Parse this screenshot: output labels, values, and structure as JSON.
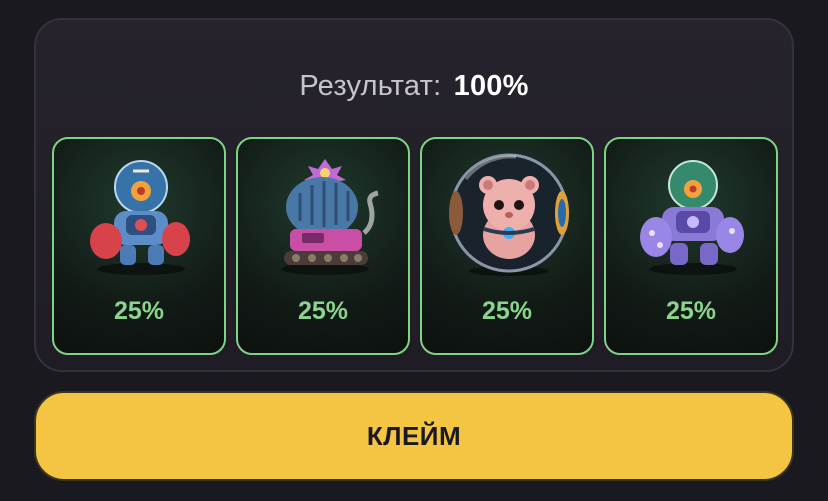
{
  "result": {
    "label": "Результат:",
    "value": "100%"
  },
  "cards": [
    {
      "icon": "astronaut-robot-icon",
      "percent": "25%"
    },
    {
      "icon": "cactus-tank-icon",
      "percent": "25%"
    },
    {
      "icon": "hamster-ball-icon",
      "percent": "25%"
    },
    {
      "icon": "purple-robot-icon",
      "percent": "25%"
    }
  ],
  "claim_button": {
    "label": "КЛЕЙМ"
  },
  "colors": {
    "background": "#1b1920",
    "panel": "#24212a",
    "card_border": "#7ed385",
    "percent_text": "#8bd48e",
    "claim_button": "#f4c443"
  }
}
